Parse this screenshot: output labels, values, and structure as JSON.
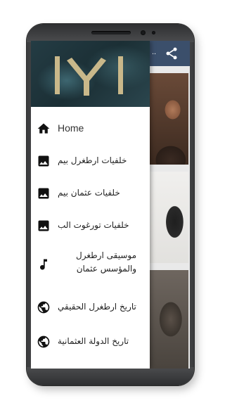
{
  "appbar": {
    "title_fragment": "..",
    "share_icon": "share-icon",
    "color": "#3b4f6b"
  },
  "drawer": {
    "header_logo": "iyi-logo",
    "items": [
      {
        "label": "Home",
        "icon": "home-icon"
      },
      {
        "label": "خلفيات ارطغرل بيم",
        "icon": "image-icon"
      },
      {
        "label": "خلفيات عثمان بيم",
        "icon": "image-icon"
      },
      {
        "label": "خلفيات تورغوت الب",
        "icon": "image-icon"
      },
      {
        "label": "موسيقى ارطغرل والمؤسس عثمان",
        "line1": "موسيقى ارطغرل",
        "line2": "والمؤسس عثمان",
        "icon": "music-note-icon"
      },
      {
        "label": "تاريخ ارطغرل الحقيقي",
        "icon": "globe-icon"
      },
      {
        "label": "تاريخ الدولة العثمانية",
        "icon": "globe-icon"
      }
    ]
  }
}
